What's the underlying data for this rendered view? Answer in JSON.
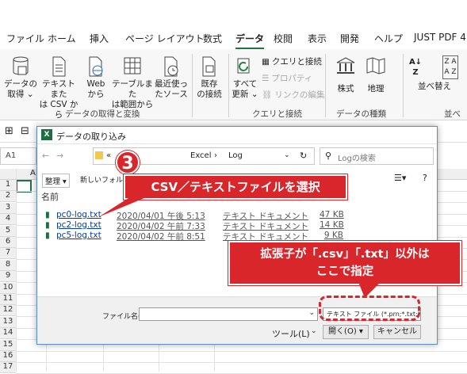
{
  "ribbon": {
    "tabs": [
      "ファイル",
      "ホーム",
      "挿入",
      "ページ レイアウト",
      "数式",
      "データ",
      "校閲",
      "表示",
      "開発",
      "ヘルプ",
      "JUST PDF 4"
    ],
    "active_tab": "データ",
    "buttons": {
      "get_data": [
        "データの",
        "取得 ⌄"
      ],
      "text_csv": [
        "テキストまた",
        "は CSV から"
      ],
      "web": [
        "Web",
        "から"
      ],
      "table_range": [
        "テーブルまた",
        "は範囲から"
      ],
      "recent": [
        "最近使っ",
        "たソース"
      ],
      "existing": [
        "既存",
        "の接続"
      ],
      "refresh_all": [
        "すべて",
        "更新 ⌄"
      ],
      "queries": "クエリと接続",
      "properties": "プロパティ",
      "edit_links": "リンクの編集",
      "stocks": "株式",
      "geography": "地理",
      "sort": "並べ替え"
    },
    "group_labels": [
      "データの取得と変換",
      "クエリと接続",
      "データの種類",
      "並べ"
    ]
  },
  "sheet": {
    "name_box": "A1",
    "col_a": "A",
    "row_numbers": [
      "1",
      "2",
      "3",
      "4",
      "5",
      "6",
      "7",
      "8",
      "9",
      "10",
      "11",
      "12",
      "13",
      "14",
      "15",
      "16",
      "17"
    ]
  },
  "dialog": {
    "title": "データの取り込み",
    "address": [
      "«",
      "Excel",
      "Log"
    ],
    "search_placeholder": "Logの検索",
    "organize": "整理 ▾",
    "new_folder": "新しいフォルダー",
    "column_name": "名前",
    "files": [
      {
        "name": "pc0-log.txt",
        "date": "2020/04/01 午後 5:13",
        "type": "テキスト ドキュメント",
        "size": "47 KB"
      },
      {
        "name": "pc2-log.txt",
        "date": "2020/04/02 午前 7:33",
        "type": "テキスト ドキュメント",
        "size": "14 KB"
      },
      {
        "name": "pc5-log.txt",
        "date": "2020/04/02 午前 8:51",
        "type": "テキスト ドキュメント",
        "size": "9 KB"
      }
    ],
    "filename_label": "ファイル名(N):",
    "filetype_value": "テキスト ファイル (*.prn;*.txt;*.csv)",
    "tools": "ツール(L)",
    "open": "開く(O)",
    "cancel": "キャンセル"
  },
  "callouts": {
    "step_number": "3",
    "select_file": "CSV／テキストファイルを選択",
    "ext_note_line1": "拡張子が「.csv」「.txt」以外は",
    "ext_note_line2": "ここで指定"
  }
}
